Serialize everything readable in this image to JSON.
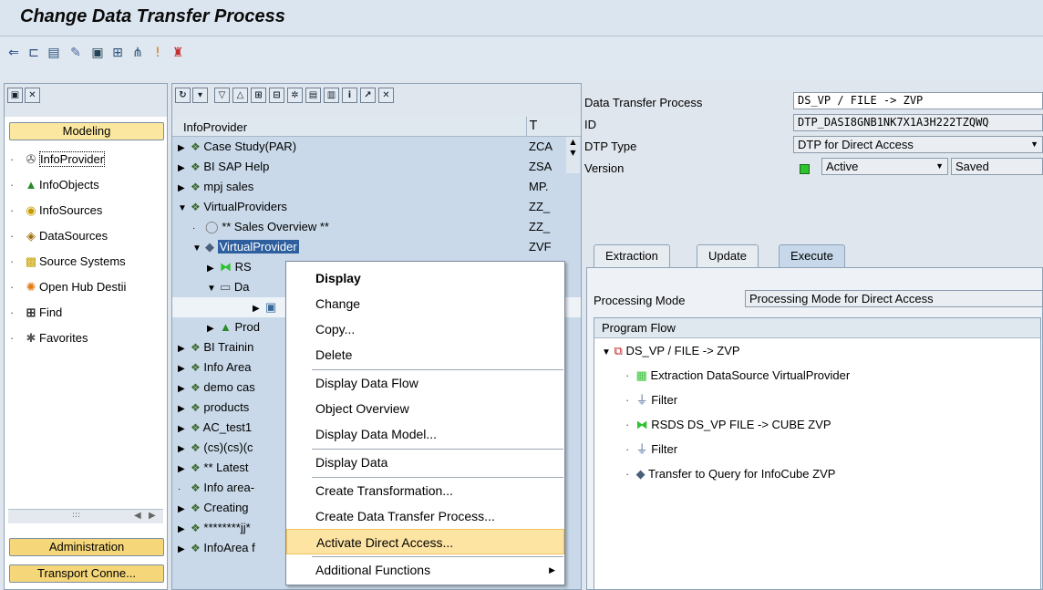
{
  "title": "Change Data Transfer Process",
  "toolbar_icons": [
    "back-arrow-icon",
    "hierarchy-icon",
    "display-icon",
    "pencil-icon",
    "check-icon",
    "structure-icon",
    "network-icon",
    "info-icon",
    "stamp-icon"
  ],
  "nav": {
    "sections": {
      "modeling": "Modeling",
      "administration": "Administration",
      "transport": "Transport Conne..."
    },
    "items": [
      {
        "label": "InfoProvider",
        "icon": "infoprovider-icon"
      },
      {
        "label": "InfoObjects",
        "icon": "infoobjects-icon"
      },
      {
        "label": "InfoSources",
        "icon": "infosources-icon"
      },
      {
        "label": "DataSources",
        "icon": "datasources-icon"
      },
      {
        "label": "Source Systems",
        "icon": "source-systems-icon"
      },
      {
        "label": "Open Hub Destii",
        "icon": "open-hub-icon"
      },
      {
        "label": "Find",
        "icon": "find-icon"
      },
      {
        "label": "Favorites",
        "icon": "favorites-icon"
      }
    ],
    "scroll_mark": ":::"
  },
  "tree": {
    "col_name": "InfoProvider",
    "col_tech": "T",
    "rows": [
      {
        "name": "Case Study(PAR)",
        "tech": "ZCA"
      },
      {
        "name": "BI SAP Help",
        "tech": "ZSA"
      },
      {
        "name": "mpj sales",
        "tech": "MP."
      },
      {
        "name": "VirtualProviders",
        "tech": "ZZ_"
      },
      {
        "name": "** Sales Overview **",
        "tech": "ZZ_"
      },
      {
        "name": "VirtualProvider",
        "tech": "ZVF"
      },
      {
        "name": "RS",
        "tech": ""
      },
      {
        "name": "Da",
        "tech": ""
      },
      {
        "name": "",
        "tech": ""
      },
      {
        "name": "Prod",
        "tech": ""
      },
      {
        "name": "BI Trainin",
        "tech": ""
      },
      {
        "name": "Info Area",
        "tech": ""
      },
      {
        "name": "demo cas",
        "tech": ""
      },
      {
        "name": "products",
        "tech": ""
      },
      {
        "name": "AC_test1",
        "tech": ""
      },
      {
        "name": "(cs)(cs)(c",
        "tech": ""
      },
      {
        "name": "** Latest",
        "tech": ""
      },
      {
        "name": "Info area-",
        "tech": ""
      },
      {
        "name": "Creating",
        "tech": ""
      },
      {
        "name": "********jj*",
        "tech": ""
      },
      {
        "name": "InfoArea f",
        "tech": ""
      }
    ]
  },
  "context_menu": {
    "items": [
      {
        "label": "Display",
        "bold": true
      },
      {
        "label": "Change"
      },
      {
        "label": "Copy..."
      },
      {
        "label": "Delete"
      },
      {
        "label": "Display Data Flow"
      },
      {
        "label": "Object Overview"
      },
      {
        "label": "Display Data Model..."
      },
      {
        "label": "Display Data"
      },
      {
        "label": "Create Transformation..."
      },
      {
        "label": "Create Data Transfer Process..."
      },
      {
        "label": "Activate Direct Access...",
        "highlight": true
      },
      {
        "label": "Additional Functions",
        "submenu": true
      }
    ]
  },
  "dtp": {
    "fields": {
      "dtp_label": "Data Transfer Process",
      "dtp_value": "DS_VP / FILE -> ZVP",
      "id_label": "ID",
      "id_value": "DTP_DASI8GNB1NK7X1A3H222TZQWQ",
      "type_label": "DTP Type",
      "type_value": "DTP for Direct Access",
      "version_label": "Version",
      "version_value": "Active",
      "status_value": "Saved"
    },
    "tabs": [
      "Extraction",
      "Update",
      "Execute"
    ],
    "active_tab": "Execute",
    "processing_label": "Processing Mode",
    "processing_value": "Processing Mode for Direct Access",
    "program_flow": {
      "header": "Program Flow",
      "root": "DS_VP / FILE -> ZVP",
      "steps": [
        "Extraction DataSource VirtualProvider",
        "Filter",
        "RSDS DS_VP FILE -> CUBE ZVP",
        "Filter",
        "Transfer to Query for InfoCube ZVP"
      ]
    }
  },
  "colors": {
    "menu_highlight": "#fde4a3",
    "tree_bg": "#c9d9e9",
    "section_button": "#fbe79f"
  }
}
